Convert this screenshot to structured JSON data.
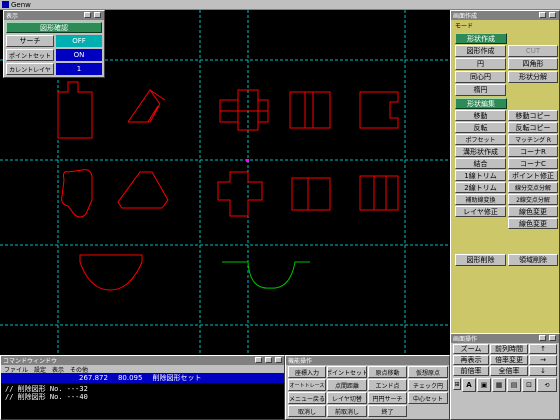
{
  "app": {
    "title": "Genw"
  },
  "display_window": {
    "title": "表示",
    "header": "図形確認",
    "rows": [
      {
        "label": "サーチ",
        "value": "OFF"
      },
      {
        "label": "ポイントセット",
        "value": "ON"
      },
      {
        "label": "カレントレイヤ",
        "value": "1"
      }
    ]
  },
  "mode_panel": {
    "title": "画面作成",
    "subtitle": "モード",
    "section_shape_create": "形状作成",
    "shape_create_buttons": [
      "図形作成",
      "CUT",
      "円",
      "四角形",
      "同心円",
      "形状分解"
    ],
    "single_button": "楕円",
    "section_shape_edit": "形状編集",
    "shape_edit_buttons": [
      "移動",
      "移動コピー",
      "反転",
      "反転コピー",
      "ポフセット",
      "マッチング R",
      "溝形状作成",
      "コーナR",
      "結合",
      "コーナC",
      "1線トリム",
      "ポイント修正",
      "2線トリム",
      "線分交点分解",
      "補助線変換",
      "2線交点分解",
      "レイヤ修正",
      "線色変更",
      "線色変更"
    ],
    "bottom_buttons": [
      "図形削除",
      "領域削除"
    ]
  },
  "op_nav": {
    "title": "画面操作",
    "buttons": [
      "ズーム",
      "前列時間",
      "再表示",
      "倍率変更",
      "→",
      "前倍率",
      "全倍率",
      "↓"
    ],
    "icons": [
      "A-icon",
      "square-icon",
      "grid-icon",
      "grid2-icon",
      "zoom-icon",
      "undo-icon"
    ]
  },
  "command_window": {
    "title": "コマンドウィンドウ",
    "menu": [
      "ファイル",
      "設定",
      "表示",
      "その他"
    ],
    "coord_x": "267.872",
    "coord_y": "80.095",
    "status": "削除図形セット",
    "log": [
      "// 削除図形 No.  ---32",
      "// 削除図形 No.  ---40"
    ]
  },
  "func_window": {
    "title": "機能操作",
    "buttons": [
      "座標入力",
      "ポイントセット",
      "原点移動",
      "仮想原点",
      "オートトレース",
      "点間距離",
      "エンド点",
      "チェック円",
      "メニュー戻る",
      "レイヤ切替",
      "円円サーチ",
      "中心セット",
      "取消し",
      "前取消し",
      "終了"
    ]
  },
  "colors": {
    "shape": "#ff0000",
    "aux_line": "#00c0c0",
    "green_shape": "#00c000",
    "mode_bg": "#ccc86a",
    "header_green": "#2e8b57"
  }
}
